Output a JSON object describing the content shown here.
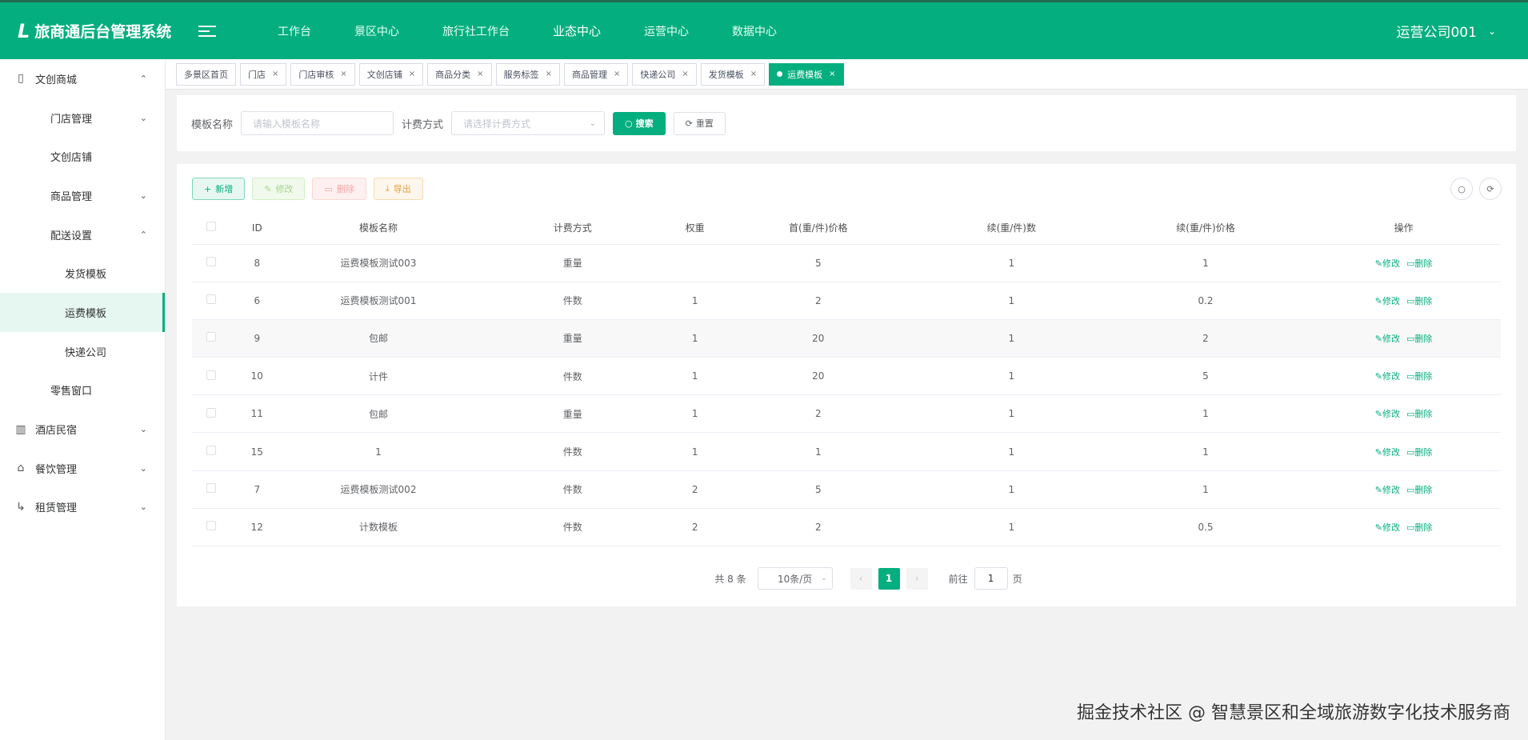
{
  "header": {
    "logo_mark": "L",
    "title": "旅商通后台管理系统",
    "nav": [
      "工作台",
      "景区中心",
      "旅行社工作台",
      "业态中心",
      "运营中心",
      "数据中心"
    ],
    "active_nav": "业态中心",
    "user": "运营公司001",
    "brand_color": "#05ae7e"
  },
  "sidebar": {
    "items": [
      {
        "label": "文创商城",
        "icon": "book-icon",
        "level": 1,
        "arrow": "up"
      },
      {
        "label": "门店管理",
        "level": 2,
        "arrow": "down"
      },
      {
        "label": "文创店铺",
        "level": 2
      },
      {
        "label": "商品管理",
        "level": 2,
        "arrow": "down"
      },
      {
        "label": "配送设置",
        "level": 2,
        "arrow": "up"
      },
      {
        "label": "发货模板",
        "level": 3
      },
      {
        "label": "运费模板",
        "level": 3,
        "active": true
      },
      {
        "label": "快递公司",
        "level": 3
      },
      {
        "label": "零售窗口",
        "level": 2
      },
      {
        "label": "酒店民宿",
        "icon": "building-icon",
        "level": 1,
        "arrow": "down"
      },
      {
        "label": "餐饮管理",
        "icon": "dish-icon",
        "level": 1,
        "arrow": "down"
      },
      {
        "label": "租赁管理",
        "icon": "exit-icon",
        "level": 1,
        "arrow": "down"
      }
    ]
  },
  "tabs": [
    "多景区首页",
    "门店",
    "门店审核",
    "文创店铺",
    "商品分类",
    "服务标签",
    "商品管理",
    "快递公司",
    "发货模板",
    "运费模板"
  ],
  "active_tab": "运费模板",
  "search": {
    "name_label": "模板名称",
    "name_placeholder": "请输入模板名称",
    "method_label": "计费方式",
    "method_placeholder": "请选择计费方式",
    "search_btn": "搜索",
    "reset_btn": "重置"
  },
  "toolbar": {
    "add": "新增",
    "edit": "修改",
    "delete": "删除",
    "export": "导出"
  },
  "table": {
    "columns": [
      "ID",
      "模板名称",
      "计费方式",
      "权重",
      "首(重/件)价格",
      "续(重/件)数",
      "续(重/件)价格",
      "操作"
    ],
    "rows": [
      [
        "8",
        "运费模板测试003",
        "重量",
        "",
        "5",
        "1",
        "1"
      ],
      [
        "6",
        "运费模板测试001",
        "件数",
        "1",
        "2",
        "1",
        "0.2"
      ],
      [
        "9",
        "包邮",
        "重量",
        "1",
        "20",
        "1",
        "2"
      ],
      [
        "10",
        "计件",
        "件数",
        "1",
        "20",
        "1",
        "5"
      ],
      [
        "11",
        "包邮",
        "重量",
        "1",
        "2",
        "1",
        "1"
      ],
      [
        "15",
        "1",
        "件数",
        "1",
        "1",
        "1",
        "1"
      ],
      [
        "7",
        "运费模板测试002",
        "件数",
        "2",
        "5",
        "1",
        "1"
      ],
      [
        "12",
        "计数模板",
        "件数",
        "2",
        "2",
        "1",
        "0.5"
      ]
    ],
    "edit_label": "修改",
    "delete_label": "删除"
  },
  "pagination": {
    "total_text": "共 8 条",
    "page_size": "10条/页",
    "current_page": "1",
    "goto_label": "前往",
    "goto_value": "1",
    "page_unit": "页"
  },
  "watermark": "掘金技术社区 @ 智慧景区和全域旅游数字化技术服务商"
}
